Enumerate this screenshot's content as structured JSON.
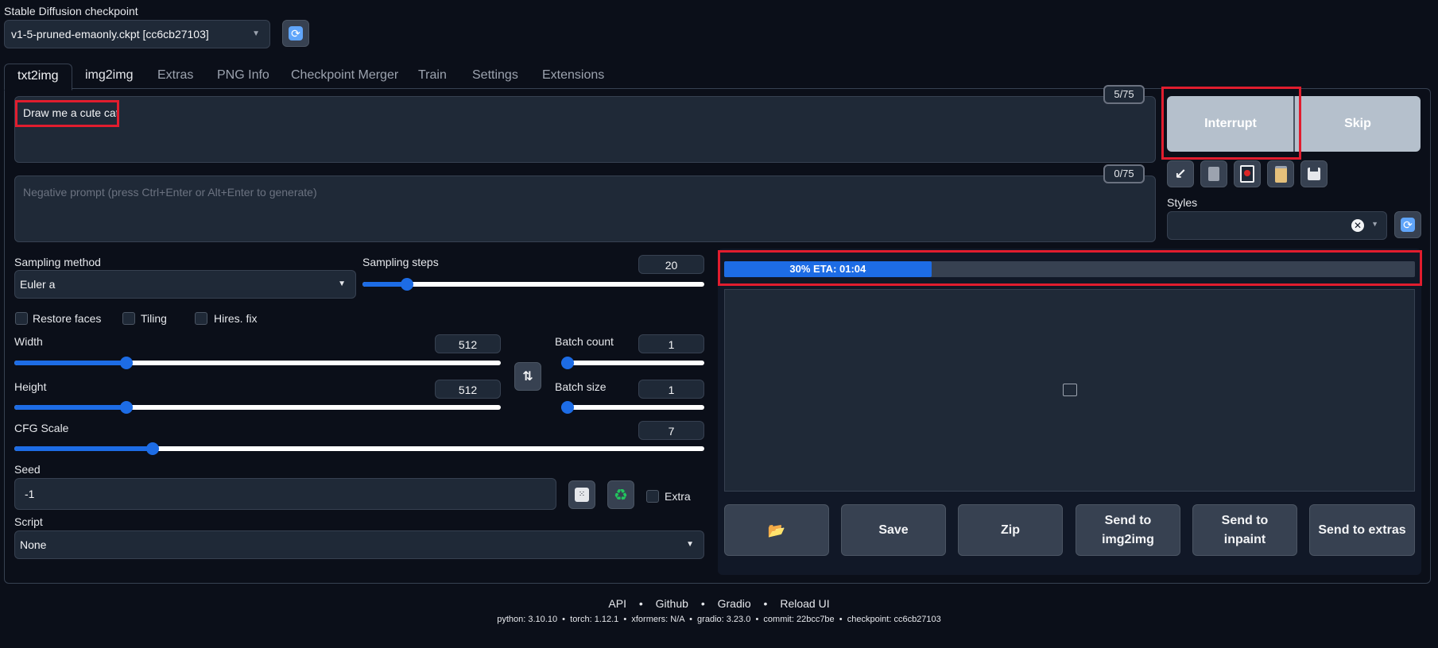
{
  "checkpoint": {
    "label": "Stable Diffusion checkpoint",
    "value": "v1-5-pruned-emaonly.ckpt [cc6cb27103]"
  },
  "tabs": [
    "txt2img",
    "img2img",
    "Extras",
    "PNG Info",
    "Checkpoint Merger",
    "Train",
    "Settings",
    "Extensions"
  ],
  "prompt": {
    "value": "Draw me a cute cat",
    "token_count": "5/75"
  },
  "negative_prompt": {
    "placeholder": "Negative prompt (press Ctrl+Enter or Alt+Enter to generate)",
    "token_count": "0/75"
  },
  "actions": {
    "interrupt": "Interrupt",
    "skip": "Skip"
  },
  "styles": {
    "label": "Styles",
    "value": ""
  },
  "sampling": {
    "method_label": "Sampling method",
    "method_value": "Euler a",
    "steps_label": "Sampling steps",
    "steps_value": "20",
    "steps_fraction": 0.13
  },
  "checkboxes": {
    "restore_faces": "Restore faces",
    "tiling": "Tiling",
    "hires_fix": "Hires. fix"
  },
  "width": {
    "label": "Width",
    "value": "512",
    "fraction": 0.23
  },
  "height": {
    "label": "Height",
    "value": "512",
    "fraction": 0.23
  },
  "batch_count": {
    "label": "Batch count",
    "value": "1",
    "fraction": 0.0
  },
  "batch_size": {
    "label": "Batch size",
    "value": "1",
    "fraction": 0.0
  },
  "cfg_scale": {
    "label": "CFG Scale",
    "value": "7",
    "fraction": 0.2
  },
  "seed": {
    "label": "Seed",
    "value": "-1",
    "extra_label": "Extra"
  },
  "script": {
    "label": "Script",
    "value": "None"
  },
  "progress": {
    "text": "30% ETA: 01:04",
    "fraction": 0.3
  },
  "gallery_buttons": {
    "folder": "📂",
    "save": "Save",
    "zip": "Zip",
    "send_img2img": "Send to img2img",
    "send_inpaint": "Send to inpaint",
    "send_extras": "Send to extras"
  },
  "footer": {
    "links": [
      "API",
      "Github",
      "Gradio",
      "Reload UI"
    ],
    "versions": "python: 3.10.10  •  torch: 1.12.1  •  xformers: N/A  •  gradio: 3.23.0  •  commit: 22bcc7be  •  checkpoint: cc6cb27103"
  },
  "colors": {
    "accent": "#1d6ce5",
    "highlight": "#e11d2e",
    "background": "#0b0f19"
  }
}
